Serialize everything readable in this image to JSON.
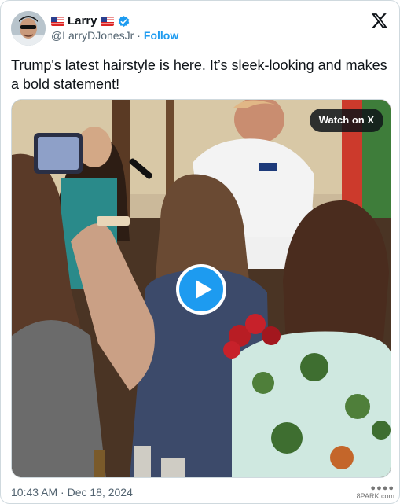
{
  "author": {
    "display_name": "Larry",
    "handle": "@LarryDJonesJr",
    "separator": "·",
    "follow_label": "Follow"
  },
  "tweet": {
    "text": "Trump's latest hairstyle is here. It’s sleek-looking and makes a bold statement!",
    "timestamp": "10:43 AM · Dec 18, 2024"
  },
  "media": {
    "watch_label": "Watch on X"
  },
  "watermark": {
    "text": "8PARK.com"
  },
  "colors": {
    "accent": "#1d9bf0",
    "text_primary": "#0f1419",
    "text_secondary": "#536471"
  },
  "icons": [
    "flag-us-icon",
    "verified-badge-icon",
    "x-logo-icon",
    "play-icon"
  ]
}
